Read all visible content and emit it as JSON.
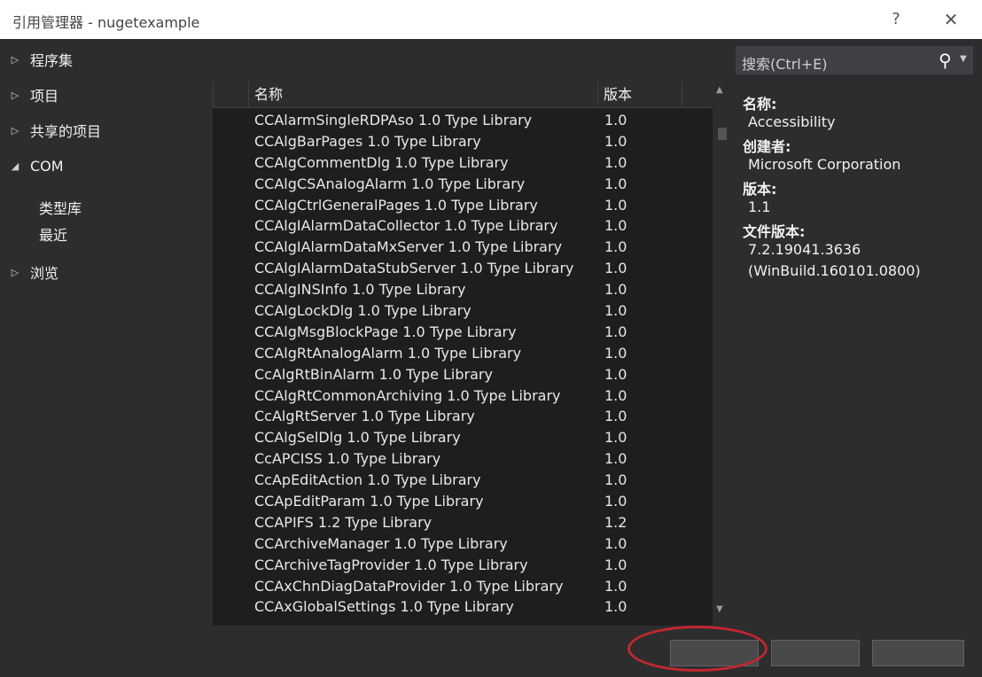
{
  "window": {
    "title": "引用管理器 - nugetexample",
    "help_label": "?",
    "close_label": "✕"
  },
  "sidebar": {
    "items": [
      {
        "label": "程序集",
        "arrow": "▷"
      },
      {
        "label": "项目",
        "arrow": "▷"
      },
      {
        "label": "共享的项目",
        "arrow": "▷"
      },
      {
        "label": "COM",
        "arrow": "◢"
      },
      {
        "label": "浏览",
        "arrow": "▷"
      }
    ],
    "sub_items": [
      "类型库",
      "最近"
    ]
  },
  "list": {
    "columns": [
      "名称",
      "版本"
    ],
    "rows": [
      {
        "name": "CCAlarmSingleRDPAso 1.0 Type Library",
        "version": "1.0"
      },
      {
        "name": "CCAlgBarPages 1.0 Type Library",
        "version": "1.0"
      },
      {
        "name": "CCAlgCommentDlg 1.0 Type Library",
        "version": "1.0"
      },
      {
        "name": "CCAlgCSAnalogAlarm 1.0 Type Library",
        "version": "1.0"
      },
      {
        "name": "CCAlgCtrlGeneralPages 1.0 Type Library",
        "version": "1.0"
      },
      {
        "name": "CCAlgIAlarmDataCollector 1.0 Type Library",
        "version": "1.0"
      },
      {
        "name": "CCAlgIAlarmDataMxServer 1.0 Type Library",
        "version": "1.0"
      },
      {
        "name": "CCAlgIAlarmDataStubServer 1.0 Type Library",
        "version": "1.0"
      },
      {
        "name": "CCAlgINSInfo 1.0 Type Library",
        "version": "1.0"
      },
      {
        "name": "CCAlgLockDlg 1.0 Type Library",
        "version": "1.0"
      },
      {
        "name": "CCAlgMsgBlockPage 1.0 Type Library",
        "version": "1.0"
      },
      {
        "name": "CCAlgRtAnalogAlarm 1.0 Type Library",
        "version": "1.0"
      },
      {
        "name": "CcAlgRtBinAlarm 1.0 Type Library",
        "version": "1.0"
      },
      {
        "name": "CCAlgRtCommonArchiving 1.0 Type Library",
        "version": "1.0"
      },
      {
        "name": "CcAlgRtServer 1.0 Type Library",
        "version": "1.0"
      },
      {
        "name": "CCAlgSelDlg 1.0 Type Library",
        "version": "1.0"
      },
      {
        "name": "CcAPCISS 1.0 Type Library",
        "version": "1.0"
      },
      {
        "name": "CcApEditAction 1.0 Type Library",
        "version": "1.0"
      },
      {
        "name": "CCApEditParam 1.0 Type Library",
        "version": "1.0"
      },
      {
        "name": "CCAPIFS 1.2 Type Library",
        "version": "1.2"
      },
      {
        "name": "CCArchiveManager 1.0 Type Library",
        "version": "1.0"
      },
      {
        "name": "CCArchiveTagProvider 1.0 Type Library",
        "version": "1.0"
      },
      {
        "name": "CCAxChnDiagDataProvider 1.0 Type Library",
        "version": "1.0"
      },
      {
        "name": "CCAxGlobalSettings 1.0 Type Library",
        "version": "1.0"
      }
    ]
  },
  "search": {
    "placeholder": "搜索(Ctrl+E)",
    "icon": "search-icon"
  },
  "details": {
    "name_label": "名称:",
    "name_value": "Accessibility",
    "creator_label": "创建者:",
    "creator_value": "Microsoft Corporation",
    "version_label": "版本:",
    "version_value": "1.1",
    "file_version_label": "文件版本:",
    "file_version_value_1": "7.2.19041.3636",
    "file_version_value_2": "(WinBuild.160101.0800)"
  },
  "colors": {
    "background": "#2d2d30",
    "list_background": "#1e1e1e",
    "highlight_circle": "#c0282d"
  }
}
